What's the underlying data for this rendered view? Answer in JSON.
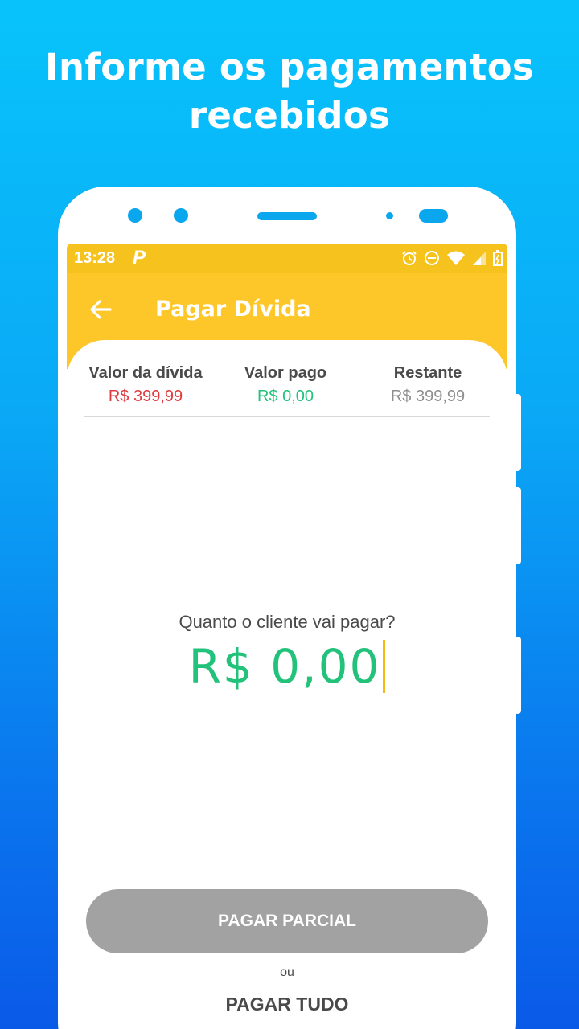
{
  "headline": {
    "line1": "Informe os pagamentos",
    "line2": "recebidos"
  },
  "status_bar": {
    "time": "13:28",
    "app_badge": "P",
    "icons": [
      "alarm-icon",
      "do-not-disturb-icon",
      "wifi-icon",
      "signal-icon",
      "battery-icon"
    ]
  },
  "app_bar": {
    "title": "Pagar Dívida",
    "back_icon": "arrow-left-icon"
  },
  "summary": {
    "debt_label": "Valor da dívida",
    "debt_value": "R$ 399,99",
    "paid_label": "Valor pago",
    "paid_value": "R$ 0,00",
    "remaining_label": "Restante",
    "remaining_value": "R$ 399,99"
  },
  "payment": {
    "question": "Quanto o cliente vai pagar?",
    "amount": "R$ 0,00"
  },
  "actions": {
    "partial_label": "PAGAR PARCIAL",
    "or_label": "ou",
    "all_label": "PAGAR TUDO"
  },
  "colors": {
    "background_top": "#08c3fb",
    "background_bottom": "#0a5ae8",
    "app_bar": "#fdc72a",
    "status_bar": "#f6c31e",
    "debt": "#e0393e",
    "paid": "#22c27a",
    "remaining": "#8e8e8e",
    "button_disabled": "#a2a2a2"
  }
}
